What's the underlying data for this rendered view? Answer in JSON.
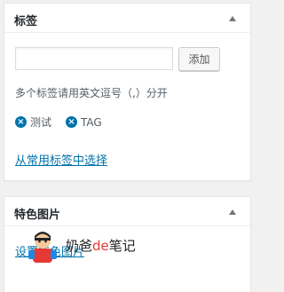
{
  "tags_box": {
    "title": "标签",
    "input_value": "",
    "input_placeholder": "",
    "add_button_label": "添加",
    "hint": "多个标签请用英文逗号（,）分开",
    "tags": [
      {
        "label": "测试"
      },
      {
        "label": "TAG"
      }
    ],
    "choose_link": "从常用标签中选择"
  },
  "featured_box": {
    "title": "特色图片",
    "set_link": "设置特色图片"
  },
  "watermark": {
    "text_before": "奶爸",
    "text_accent": "de",
    "text_after": "笔记"
  },
  "colors": {
    "link": "#0073aa",
    "remove_icon": "#0073aa",
    "accent": "#e53935"
  },
  "icons": {
    "toggle": "triangle-up-icon",
    "remove": "remove-circle-icon"
  }
}
